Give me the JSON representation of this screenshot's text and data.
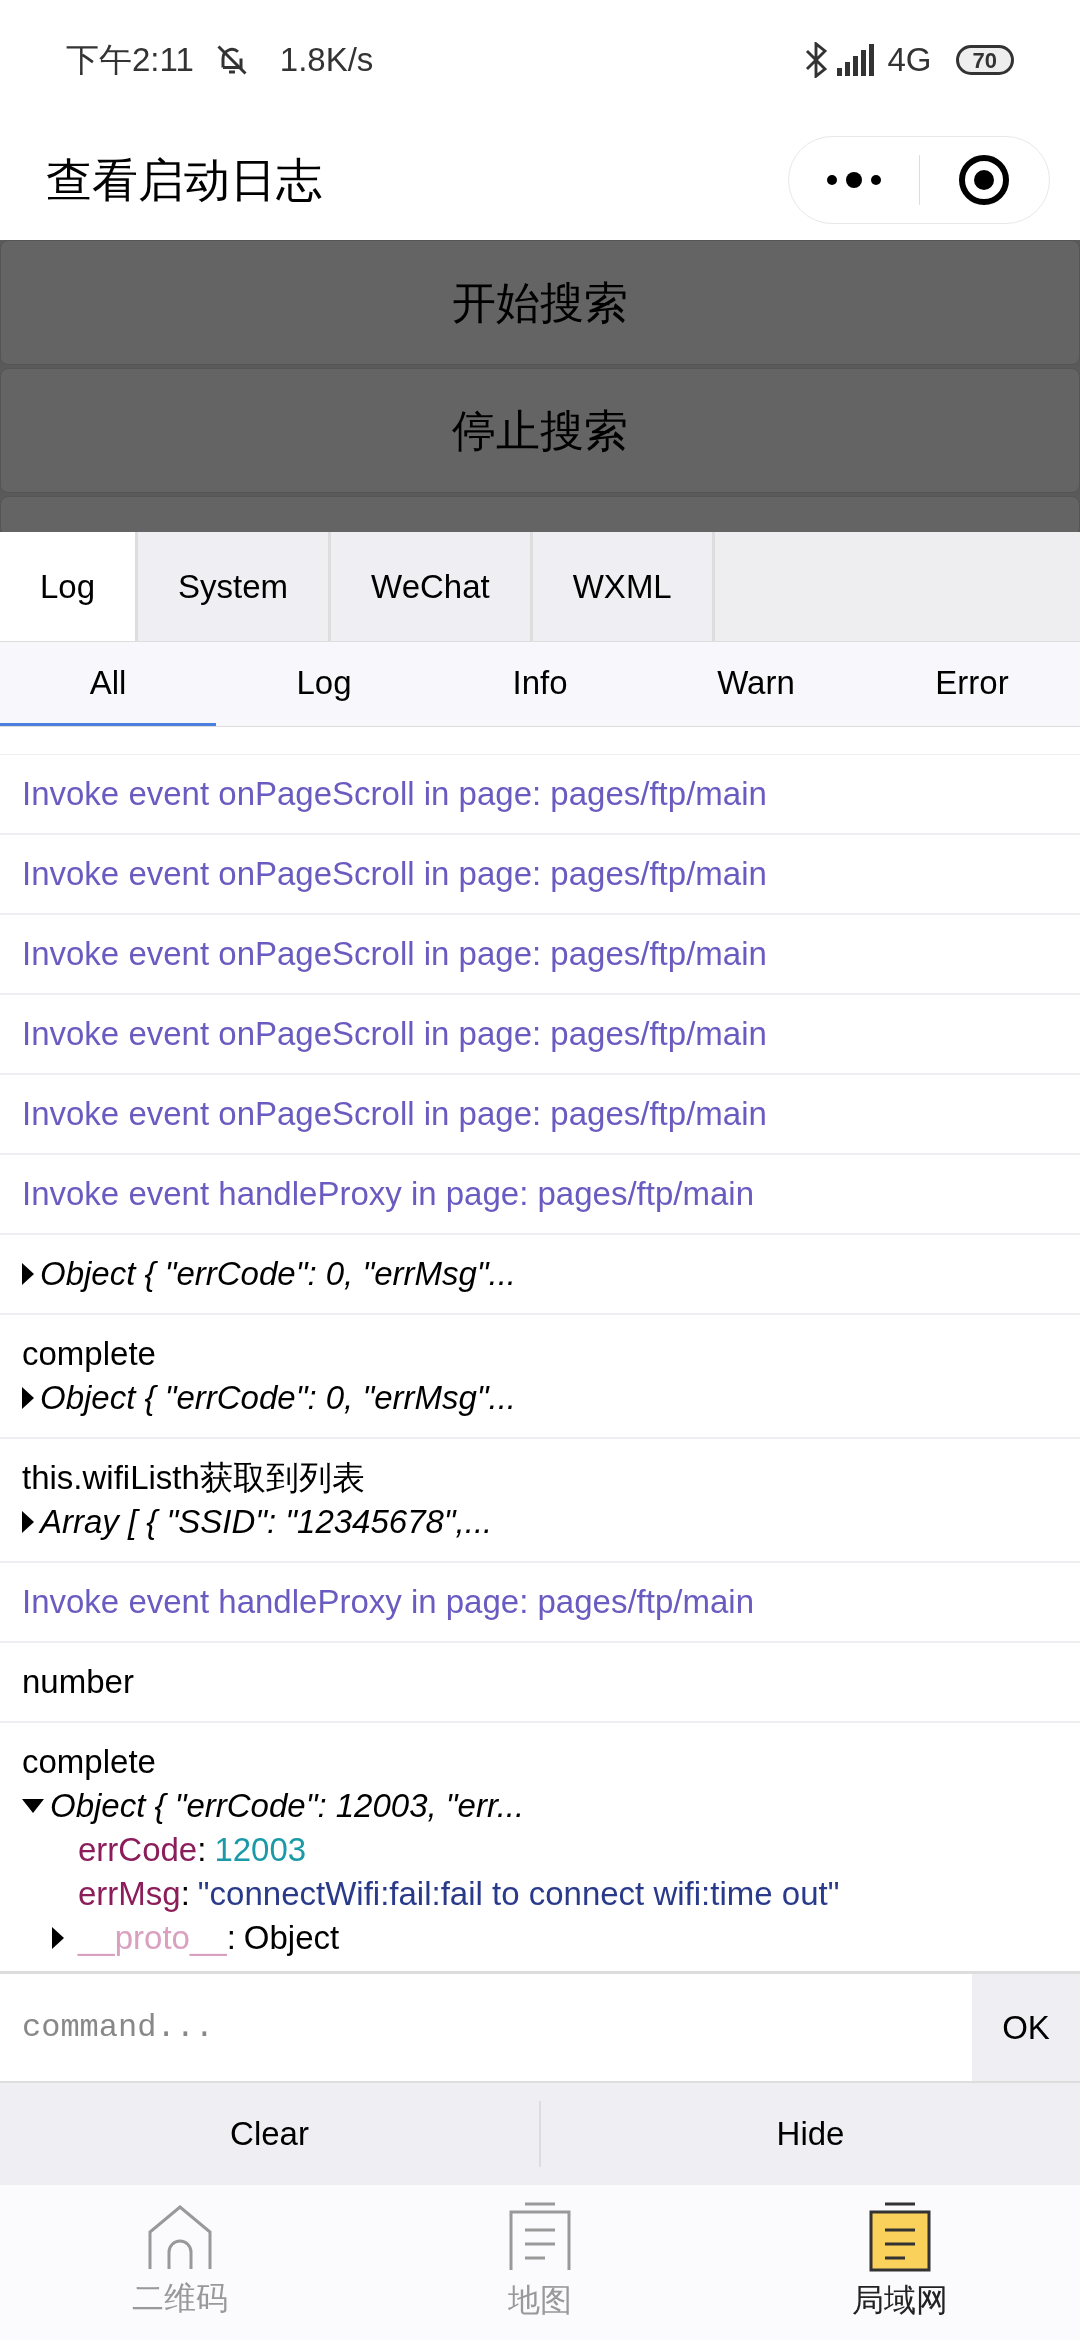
{
  "status_bar": {
    "time": "下午2:11",
    "speed": "1.8K/s",
    "network": "4G",
    "battery": "70"
  },
  "title_bar": {
    "title": "查看启动日志"
  },
  "buttons": [
    {
      "label": "开始搜索"
    },
    {
      "label": "停止搜索"
    }
  ],
  "tabs": [
    {
      "label": "Log",
      "selected": true
    },
    {
      "label": "System",
      "selected": false
    },
    {
      "label": "WeChat",
      "selected": false
    },
    {
      "label": "WXML",
      "selected": false
    }
  ],
  "filters": [
    {
      "label": "All",
      "selected": true
    },
    {
      "label": "Log",
      "selected": false
    },
    {
      "label": "Info",
      "selected": false
    },
    {
      "label": "Warn",
      "selected": false
    },
    {
      "label": "Error",
      "selected": false
    }
  ],
  "entries": [
    {
      "lines": [
        {
          "kind": "event",
          "text": "Invoke event onPageScroll in page: pages/ftp/main"
        }
      ]
    },
    {
      "lines": [
        {
          "kind": "event",
          "text": "Invoke event onPageScroll in page: pages/ftp/main"
        }
      ]
    },
    {
      "lines": [
        {
          "kind": "event",
          "text": "Invoke event onPageScroll in page: pages/ftp/main"
        }
      ]
    },
    {
      "lines": [
        {
          "kind": "event",
          "text": "Invoke event onPageScroll in page: pages/ftp/main"
        }
      ]
    },
    {
      "lines": [
        {
          "kind": "event",
          "text": "Invoke event onPageScroll in page: pages/ftp/main"
        }
      ]
    },
    {
      "lines": [
        {
          "kind": "event",
          "text": "Invoke event handleProxy in page: pages/ftp/main"
        }
      ]
    },
    {
      "lines": [
        {
          "kind": "object",
          "expanded": false,
          "text": "Object { \"errCode\": 0, \"errMsg\"..."
        }
      ]
    },
    {
      "lines": [
        {
          "kind": "text",
          "text": "complete"
        },
        {
          "kind": "object",
          "expanded": false,
          "text": "Object { \"errCode\": 0, \"errMsg\"..."
        }
      ]
    },
    {
      "lines": [
        {
          "kind": "text",
          "text": "this.wifiListh获取到列表"
        },
        {
          "kind": "object",
          "expanded": false,
          "text": "Array [ { \"SSID\": \"12345678\",..."
        }
      ]
    },
    {
      "lines": [
        {
          "kind": "event",
          "text": "Invoke event handleProxy in page: pages/ftp/main"
        }
      ]
    },
    {
      "lines": [
        {
          "kind": "text",
          "text": "number"
        }
      ]
    },
    {
      "lines": [
        {
          "kind": "text",
          "text": "complete"
        },
        {
          "kind": "object",
          "expanded": true,
          "text": "Object { \"errCode\": 12003, \"err..."
        },
        {
          "kind": "number_prop",
          "key": "errCode",
          "separator": ":",
          "value": "12003"
        },
        {
          "kind": "string_prop",
          "key": "errMsg",
          "separator": ":",
          "value": "\"connectWifi:fail:fail to connect wifi:time out\""
        },
        {
          "kind": "proto",
          "key": "__proto__",
          "separator": ":",
          "value": "Object",
          "expanded": false
        }
      ]
    }
  ],
  "command": {
    "placeholder": "command...",
    "button": "OK"
  },
  "actions": [
    {
      "label": "Clear"
    },
    {
      "label": "Hide"
    }
  ],
  "tab_bar": [
    {
      "label": "二维码",
      "selected": false
    },
    {
      "label": "地图",
      "selected": false
    },
    {
      "label": "局域网",
      "selected": true
    }
  ]
}
